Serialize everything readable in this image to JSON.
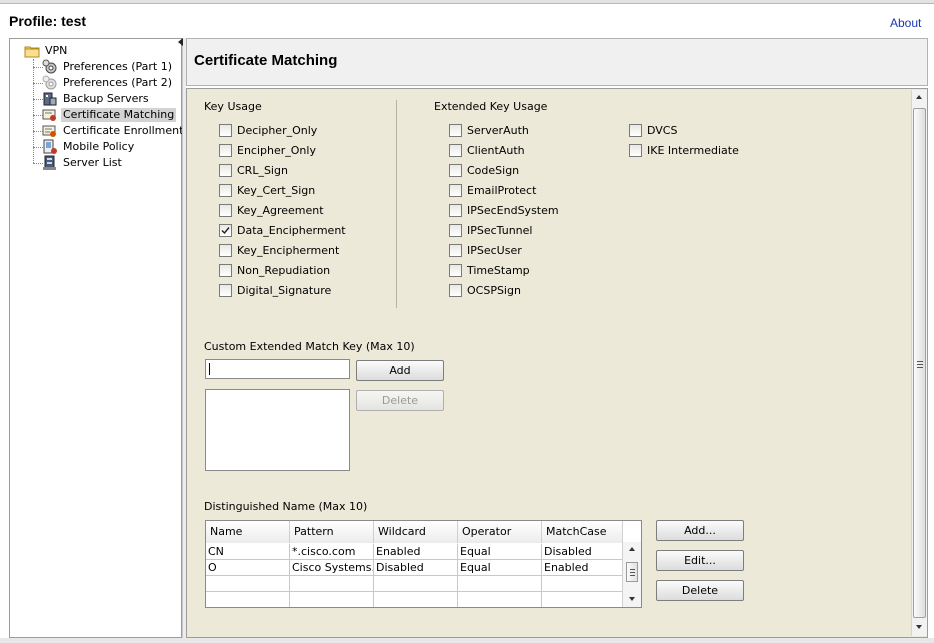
{
  "header": {
    "profile_title": "Profile:  test",
    "about_link": "About"
  },
  "tree": {
    "root_label": "VPN",
    "items": [
      {
        "label": "Preferences (Part 1)",
        "icon": "gears-icon"
      },
      {
        "label": "Preferences (Part 2)",
        "icon": "gears-faded-icon"
      },
      {
        "label": "Backup Servers",
        "icon": "server-building-icon"
      },
      {
        "label": "Certificate Matching",
        "icon": "certificate-icon",
        "selected": true
      },
      {
        "label": "Certificate Enrollment",
        "icon": "certificate-enrollment-icon"
      },
      {
        "label": "Mobile Policy",
        "icon": "mobile-policy-icon"
      },
      {
        "label": "Server List",
        "icon": "server-list-icon"
      }
    ]
  },
  "main": {
    "section_title": "Certificate Matching",
    "key_usage": {
      "label": "Key Usage",
      "options": [
        {
          "label": "Decipher_Only",
          "checked": false
        },
        {
          "label": "Encipher_Only",
          "checked": false
        },
        {
          "label": "CRL_Sign",
          "checked": false
        },
        {
          "label": "Key_Cert_Sign",
          "checked": false
        },
        {
          "label": "Key_Agreement",
          "checked": false
        },
        {
          "label": "Data_Encipherment",
          "checked": true
        },
        {
          "label": "Key_Encipherment",
          "checked": false
        },
        {
          "label": "Non_Repudiation",
          "checked": false
        },
        {
          "label": "Digital_Signature",
          "checked": false
        }
      ]
    },
    "extended_key_usage": {
      "label": "Extended Key Usage",
      "options_col1": [
        {
          "label": "ServerAuth",
          "checked": false
        },
        {
          "label": "ClientAuth",
          "checked": false
        },
        {
          "label": "CodeSign",
          "checked": false
        },
        {
          "label": "EmailProtect",
          "checked": false
        },
        {
          "label": "IPSecEndSystem",
          "checked": false
        },
        {
          "label": "IPSecTunnel",
          "checked": false
        },
        {
          "label": "IPSecUser",
          "checked": false
        },
        {
          "label": "TimeStamp",
          "checked": false
        },
        {
          "label": "OCSPSign",
          "checked": false
        }
      ],
      "options_col2": [
        {
          "label": "DVCS",
          "checked": false
        },
        {
          "label": "IKE Intermediate",
          "checked": false
        }
      ]
    },
    "custom_key": {
      "label": "Custom Extended Match Key (Max 10)",
      "input_value": "",
      "add_label": "Add",
      "delete_label": "Delete"
    },
    "distinguished_name": {
      "label": "Distinguished Name (Max 10)",
      "columns": [
        "Name",
        "Pattern",
        "Wildcard",
        "Operator",
        "MatchCase"
      ],
      "rows": [
        [
          "CN",
          "*.cisco.com",
          "Enabled",
          "Equal",
          "Disabled"
        ],
        [
          "O",
          "Cisco Systems...",
          "Disabled",
          "Equal",
          "Enabled"
        ],
        [
          "",
          "",
          "",
          "",
          ""
        ],
        [
          "",
          "",
          "",
          "",
          ""
        ]
      ],
      "add_label": "Add...",
      "edit_label": "Edit...",
      "delete_label": "Delete"
    }
  },
  "colors": {
    "content_bg": "#ece9d8",
    "link": "#1a37b0",
    "selected_bg": "#d3d3d3"
  }
}
